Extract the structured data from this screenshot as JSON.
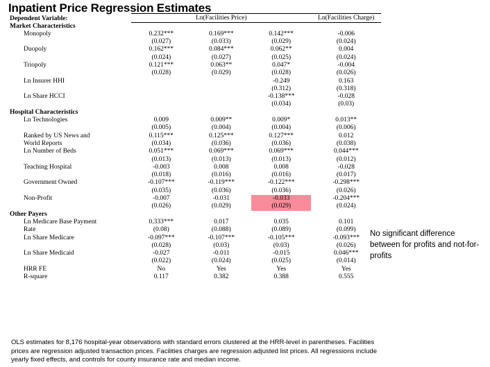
{
  "title": "Inpatient Price Regression Estimates",
  "header": {
    "dependent_variable_label": "Dependent Variable:",
    "group1": "Ln(Facilities Price)",
    "group2": "Ln(Facilities Charge)"
  },
  "sections": {
    "market": "Market Characteristics",
    "hospital": "Hospital Characteristics",
    "other": "Other Payers"
  },
  "rows": [
    {
      "label": "Monopoly",
      "coef": [
        "0.232***",
        "0.169***",
        "0.142***",
        "-0.006"
      ],
      "se": [
        "(0.027)",
        "(0.033)",
        "(0.029)",
        "(0.024)"
      ]
    },
    {
      "label": "Duopoly",
      "coef": [
        "0.162***",
        "0.084***",
        "0.062**",
        "0.004"
      ],
      "se": [
        "(0.024)",
        "(0.027)",
        "(0.025)",
        "(0.024)"
      ]
    },
    {
      "label": "Triopoly",
      "coef": [
        "0.121***",
        "0.063**",
        "0.047*",
        "-0.004"
      ],
      "se": [
        "(0.028)",
        "(0.029)",
        "(0.028)",
        "(0.026)"
      ]
    },
    {
      "label": "Ln Insurer HHI",
      "coef": [
        "",
        "",
        "-0.249",
        "0.163"
      ],
      "se": [
        "",
        "",
        "(0.312)",
        "(0.318)"
      ]
    },
    {
      "label": "Ln Share HCCI",
      "coef": [
        "",
        "",
        "-0.138***",
        "-0.028"
      ],
      "se": [
        "",
        "",
        "(0.034)",
        "(0.03)"
      ]
    },
    {
      "label": "Ln Technologies",
      "coef": [
        "0.009",
        "0.009**",
        "0.009*",
        "0.013**"
      ],
      "se": [
        "(0.005)",
        "(0.004)",
        "(0.004)",
        "(0.006)"
      ]
    },
    {
      "label": "Ranked by US News and",
      "label2": "World Reports",
      "coef": [
        "0.115***",
        "0.125***",
        "0.127***",
        "0.012"
      ],
      "se": [
        "(0.034)",
        "(0.036)",
        "(0.036)",
        "(0.038)"
      ]
    },
    {
      "label": "Ln Number of Beds",
      "coef": [
        "0.051***",
        "0.069***",
        "0.069***",
        "0.044***"
      ],
      "se": [
        "(0.013)",
        "(0.013)",
        "(0.013)",
        "(0.012)"
      ]
    },
    {
      "label": "Teaching Hospital",
      "coef": [
        "-0.003",
        "0.008",
        "0.008",
        "-0.028"
      ],
      "se": [
        "(0.018)",
        "(0.016)",
        "(0.016)",
        "(0.017)"
      ]
    },
    {
      "label": "Government Owned",
      "coef": [
        "-0.107***",
        "-0.119***",
        "-0.122***",
        "-0.298***"
      ],
      "se": [
        "(0.035)",
        "(0.036)",
        "(0.036)",
        "(0.026)"
      ]
    },
    {
      "label": "Non-Profit",
      "coef": [
        "-0.007",
        "-0.031",
        "-0.033",
        "-0.204***"
      ],
      "se": [
        "(0.026)",
        "(0.029)",
        "(0.029)",
        "(0.024)"
      ],
      "highlight": 2
    },
    {
      "label": "Ln Medicare Base Payment",
      "label2": "Rate",
      "coef": [
        "0.333***",
        "0.017",
        "0.035",
        "0.101"
      ],
      "se": [
        "(0.08)",
        "(0.088)",
        "(0.089)",
        "(0.099)"
      ]
    },
    {
      "label": "Ln Share Medicare",
      "coef": [
        "-0.097***",
        "-0.107***",
        "-0.105***",
        "-0.093***"
      ],
      "se": [
        "(0.028)",
        "(0.03)",
        "(0.03)",
        "(0.026)"
      ]
    },
    {
      "label": "Ln Share Medicaid",
      "coef": [
        "-0.027",
        "-0.011",
        "-0.015",
        "0.046***"
      ],
      "se": [
        "(0.022)",
        "(0.024)",
        "(0.025)",
        "(0.014)"
      ]
    }
  ],
  "footer_rows": [
    {
      "label": "HRR FE",
      "values": [
        "No",
        "Yes",
        "Yes",
        "Yes"
      ]
    },
    {
      "label": "R-square",
      "values": [
        "0.117",
        "0.382",
        "0.388",
        "0.555"
      ]
    }
  ],
  "footnote": "OLS estimates for 8,176 hospital-year observations with standard errors clustered at the HRR-level in parentheses. Facilities prices are regression adjusted transaction prices. Facilities charges are regression adjusted list prices. All regressions include yearly fixed effects, and controls for county insurance rate and median income.",
  "annotation": "No significant difference between for profits and not-for-profits",
  "colors": {
    "highlight": "#fa8b9b",
    "rule": "#000000",
    "text": "#000000",
    "background": "#ffffff"
  }
}
